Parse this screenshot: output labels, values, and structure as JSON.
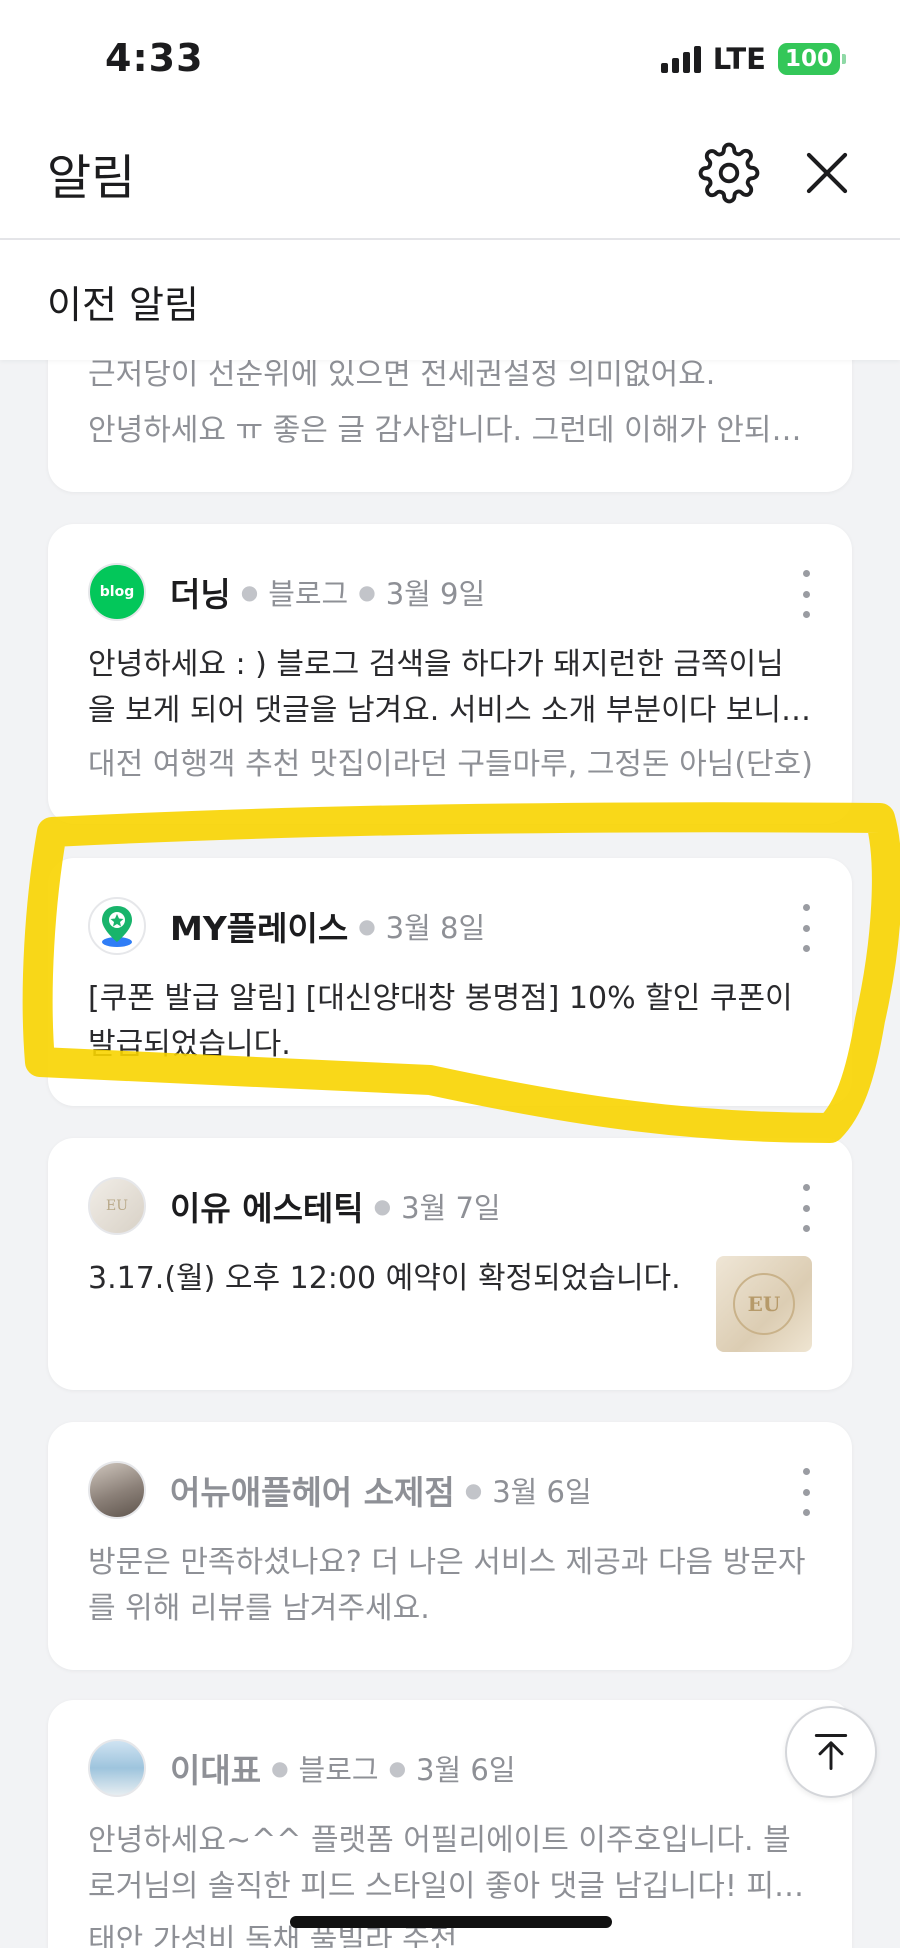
{
  "status_bar": {
    "time": "4:33",
    "network": "LTE",
    "battery": "100"
  },
  "header": {
    "title": "알림",
    "settings_icon": "gear-icon",
    "close_icon": "close-icon"
  },
  "section": {
    "title": "이전 알림"
  },
  "colors": {
    "highlight": "#f8d400",
    "blog_green": "#03c75a",
    "place_green": "#18b46b",
    "battery": "#34c759"
  },
  "notifications": [
    {
      "partial": true,
      "lines": [
        "근저당이 선순위에 있으면 전세권설정 의미없어요.",
        "안녕하세요 ㅠ 좋은 글 감사합니다. 그런데 이해가 안되는…"
      ]
    },
    {
      "sender": "더닝",
      "category": "블로그",
      "date": "3월 9일",
      "icon": "blog-icon",
      "avatar_text": "blog",
      "body": "안녕하세요 : ) 블로그 검색을 하다가 돼지런한 금쪽이님 을 보게 되어 댓글을 남겨요. 서비스 소개 부분이다 보니 비밀…",
      "sub": "대전 여행객 추천 맛집이라던 구들마루, 그정돈 아님(단호)"
    },
    {
      "sender": "MY플레이스",
      "date": "3월 8일",
      "icon": "place-pin-icon",
      "body": "[쿠폰 발급 알림]  [대신양대창 봉명점] 10% 할인 쿠폰이 발급되었습니다."
    },
    {
      "sender": "이유 에스테틱",
      "date": "3월 7일",
      "icon": "shop-avatar",
      "thumb_text": "EU",
      "avatar_text": "EU",
      "body": "3.17.(월) 오후 12:00 예약이 확정되었습니다."
    },
    {
      "sender": "어뉴애플헤어 소제점",
      "date": "3월 6일",
      "icon": "salon-avatar",
      "body": "방문은 만족하셨나요? 더 나은 서비스 제공과 다음 방문자를 위해 리뷰를 남겨주세요."
    },
    {
      "sender": "이대표",
      "category": "블로그",
      "date": "3월 6일",
      "icon": "profile-avatar",
      "body": "안녕하세요~^^ 플랫폼 어필리에이트 이주호입니다. 블로거님의 솔직한 피드 스타일이 좋아 댓글 남깁니다! 피부/두…",
      "sub": "태안 가성비 독채 풀빌라 주전"
    }
  ],
  "scroll_top_icon": "arrow-up-icon"
}
